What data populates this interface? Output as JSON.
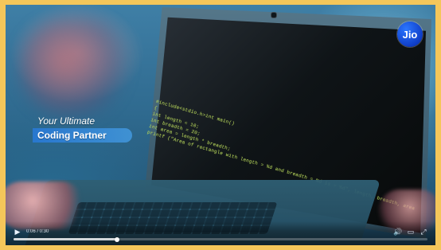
{
  "video": {
    "brand_text": "Jio",
    "tagline_line1": "Your Ultimate",
    "tagline_line2": "Coding Partner",
    "code_lines": [
      "#include<stdio.h>int main()",
      "{",
      "  int length = 10;",
      "  int breadth = 20;",
      "  int area = length * breadth;",
      "  printf (\"Area of rectangle with length = %d and breadth = %d is = %d\", length, breadth, area"
    ]
  },
  "player": {
    "time": "0:06 / 0:30",
    "progress_fraction": 0.25,
    "play_icon": "play-icon",
    "volume_icon": "volume-icon",
    "captions_icon": "captions-icon",
    "fullscreen_icon": "fullscreen-icon"
  },
  "colors": {
    "frame_border": "#f4c65a",
    "code_text": "#b4d35a",
    "brand_blue": "#1a56e6",
    "tag_bar_blue": "#2f7fd6"
  }
}
